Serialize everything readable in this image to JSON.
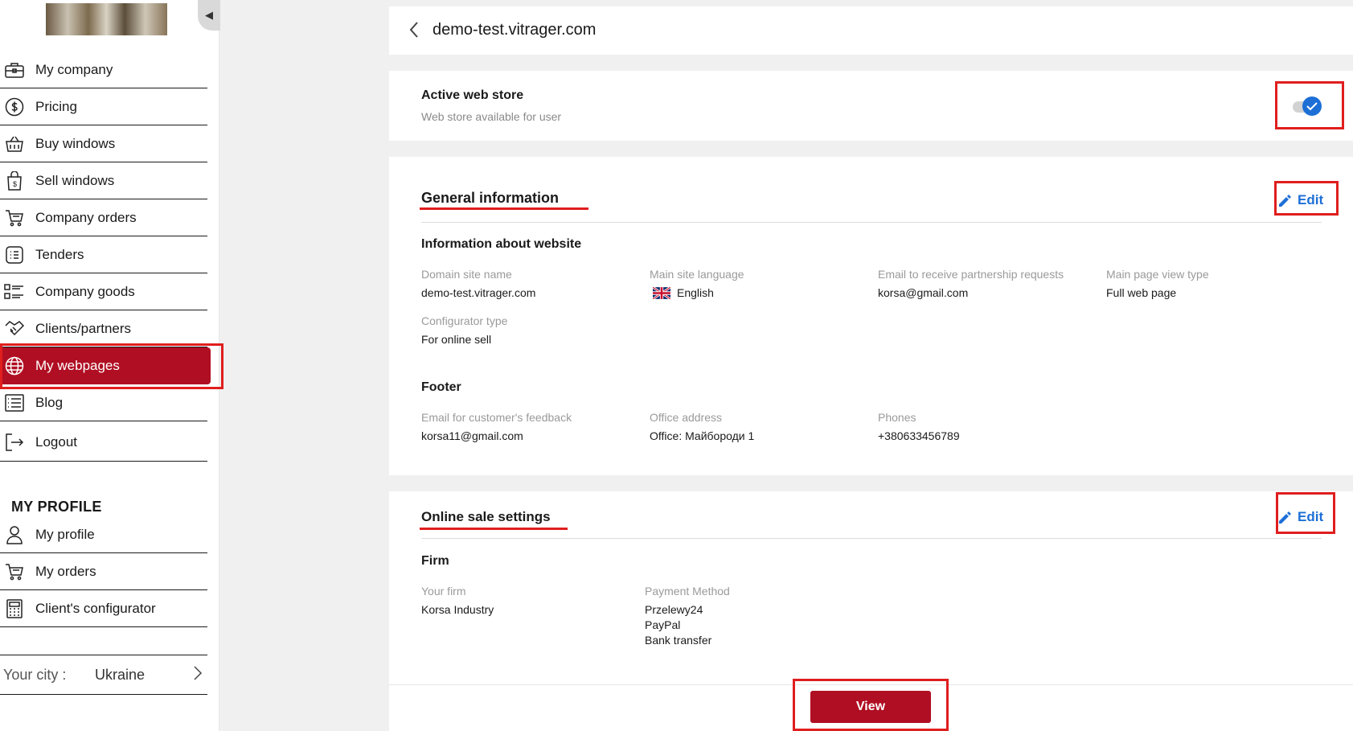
{
  "sidebar": {
    "collapse_icon": "caret-left-icon",
    "items": [
      {
        "label": "My company",
        "icon": "briefcase-icon"
      },
      {
        "label": "Pricing",
        "icon": "dollar-icon"
      },
      {
        "label": "Buy windows",
        "icon": "basket-icon"
      },
      {
        "label": "Sell windows",
        "icon": "shopping-bag-icon"
      },
      {
        "label": "Company orders",
        "icon": "cart-icon"
      },
      {
        "label": "Tenders",
        "icon": "list-icon"
      },
      {
        "label": "Company goods",
        "icon": "goods-list-icon"
      },
      {
        "label": "Clients/partners",
        "icon": "handshake-icon"
      },
      {
        "label": "My webpages",
        "icon": "globe-icon",
        "active": true
      },
      {
        "label": "Blog",
        "icon": "blog-icon"
      },
      {
        "label": "Logout",
        "icon": "logout-icon"
      }
    ],
    "profile_title": "MY PROFILE",
    "profile_items": [
      {
        "label": "My profile",
        "icon": "user-icon"
      },
      {
        "label": "My orders",
        "icon": "cart-icon"
      },
      {
        "label": "Client's configurator",
        "icon": "calculator-icon"
      }
    ],
    "city": {
      "label": "Your city :",
      "value": "Ukraine"
    }
  },
  "header": {
    "domain": "demo-test.vitrager.com"
  },
  "store": {
    "title": "Active web store",
    "subtitle": "Web store available for user",
    "enabled": true
  },
  "general": {
    "title": "General information",
    "edit_label": "Edit",
    "website": {
      "title": "Information about website",
      "fields": [
        {
          "label": "Domain site name",
          "value": "demo-test.vitrager.com"
        },
        {
          "label": "Main site language",
          "value": "English"
        },
        {
          "label": "Email to receive partnership requests",
          "value": "korsa@gmail.com"
        },
        {
          "label": "Main page view type",
          "value": "Full web page"
        },
        {
          "label": "Configurator type",
          "value": "For online sell"
        }
      ]
    },
    "footer": {
      "title": "Footer",
      "fields": [
        {
          "label": "Email for customer's feedback",
          "value": "korsa11@gmail.com"
        },
        {
          "label": "Office address",
          "value": "Office: Майбороди 1"
        },
        {
          "label": "Phones",
          "value": "+380633456789"
        }
      ]
    }
  },
  "sale": {
    "title": "Online sale settings",
    "edit_label": "Edit",
    "firm": {
      "title": "Firm",
      "your_firm_label": "Your firm",
      "your_firm_value": "Korsa Industry",
      "payment_label": "Payment Method",
      "payment_methods": [
        "Przelewy24",
        "PayPal",
        "Bank transfer"
      ]
    },
    "view_label": "View"
  },
  "colors": {
    "accent": "#b00e22",
    "link": "#1d6fd6",
    "highlight": "#e01e1e"
  }
}
